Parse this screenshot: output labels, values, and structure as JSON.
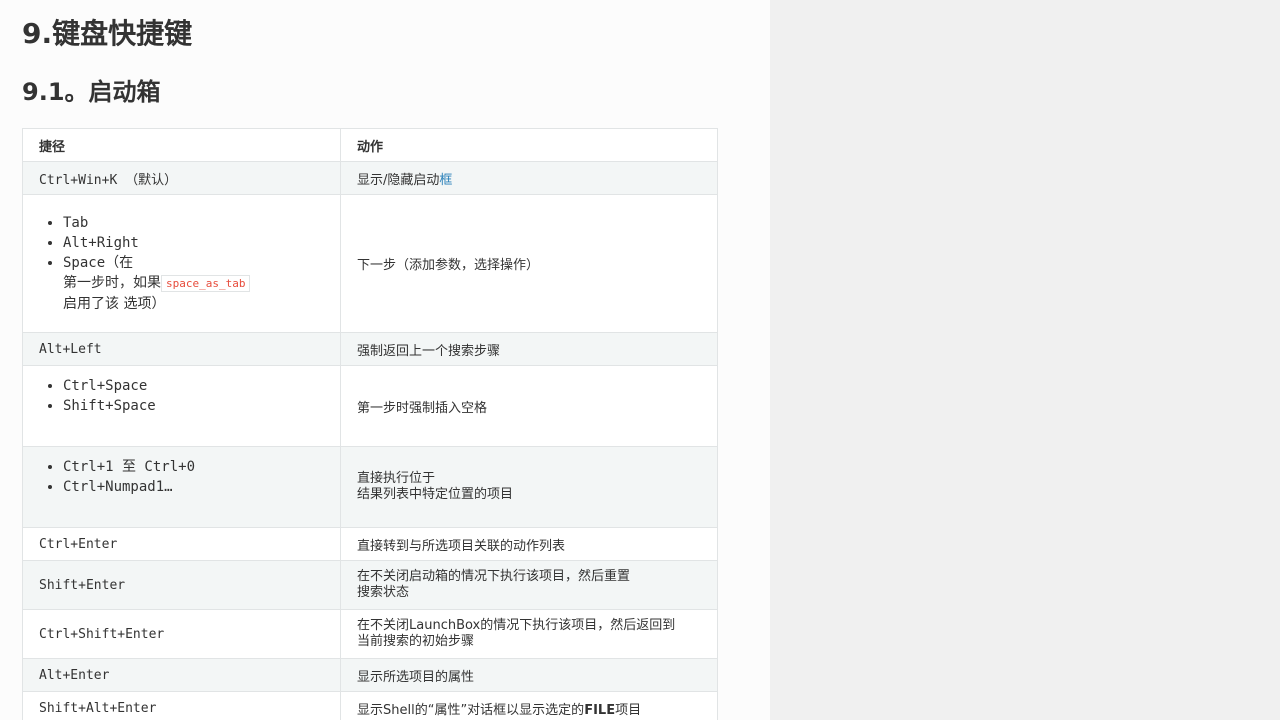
{
  "page": {
    "title": "9.键盘快捷键",
    "subtitle": "9.1。启动箱"
  },
  "table": {
    "headers": [
      "捷径",
      "动作"
    ],
    "rows": {
      "r1": {
        "shortcut": "Ctrl+Win+K （默认）",
        "action_prefix": "显示/隐藏启动",
        "action_link": "框"
      },
      "r2": {
        "items": [
          "Tab",
          "Alt+Right"
        ],
        "space_key": "Space",
        "space_note_a": "（在",
        "space_note_b": "第一步时，如果",
        "space_code": "space_as_tab",
        "space_note_c": "启用了该 选项）",
        "action": "下一步（添加参数，选择操作）"
      },
      "r3": {
        "shortcut": "Alt+Left",
        "action": "强制返回上一个搜索步骤"
      },
      "r4": {
        "items": [
          "Ctrl+Space",
          "Shift+Space"
        ],
        "action": "第一步时强制插入空格"
      },
      "r5": {
        "items": [
          "Ctrl+1 至 Ctrl+0",
          "Ctrl+Numpad1…"
        ],
        "action_line1": "直接执行位于",
        "action_line2": "结果列表中特定位置的项目"
      },
      "r6": {
        "shortcut": "Ctrl+Enter",
        "action": "直接转到与所选项目关联的动作列表"
      },
      "r7": {
        "shortcut": "Shift+Enter",
        "action_line1": "在不关闭启动箱的情况下执行该项目，然后重置",
        "action_line2": "搜索状态"
      },
      "r8": {
        "shortcut": "Ctrl+Shift+Enter",
        "action_line1": "在不关闭LaunchBox的情况下执行该项目，然后返回到",
        "action_line2": "当前搜索的初始步骤"
      },
      "r9": {
        "shortcut": "Alt+Enter",
        "action": "显示所选项目的属性"
      },
      "r10": {
        "shortcut": "Shift+Alt+Enter",
        "action_prefix": "显示Shell的“属性”对话框以显示选定的",
        "action_bold": "FILE",
        "action_suffix": "项目"
      }
    }
  }
}
